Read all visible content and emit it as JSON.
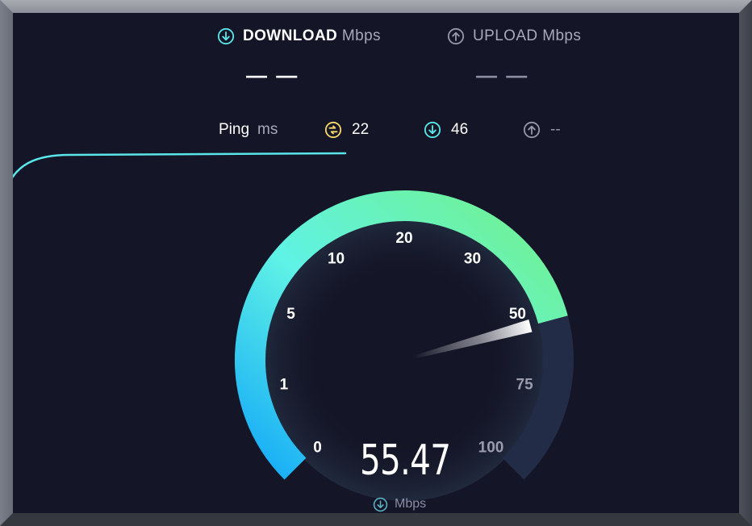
{
  "header": {
    "download": {
      "label": "DOWNLOAD",
      "unit": "Mbps",
      "value": "— —",
      "icon": "download-arrow-icon"
    },
    "upload": {
      "label": "UPLOAD",
      "unit": "Mbps",
      "value": "— —",
      "icon": "upload-arrow-icon"
    }
  },
  "ping": {
    "label": "Ping",
    "unit": "ms",
    "idle": {
      "value": "22",
      "icon": "ping-idle-icon"
    },
    "download": {
      "value": "46",
      "icon": "download-arrow-icon"
    },
    "upload": {
      "value": "--",
      "icon": "upload-arrow-icon"
    }
  },
  "gauge": {
    "ticks": [
      "0",
      "1",
      "5",
      "10",
      "20",
      "30",
      "50",
      "75",
      "100"
    ],
    "current_value": 55.47,
    "reading": "55.47",
    "unit": "Mbps"
  },
  "colors": {
    "background": "#141526",
    "accent_cyan": "#5ae6e8",
    "accent_green": "#6ff29a",
    "gauge_blue": "#19b4f5",
    "gauge_track": "#232c47",
    "ping_yellow": "#f5d76a"
  }
}
